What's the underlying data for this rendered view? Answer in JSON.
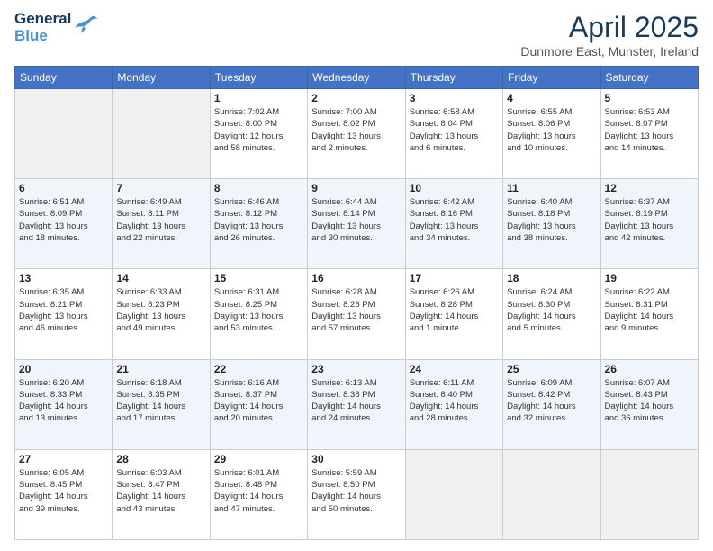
{
  "header": {
    "logo_general": "General",
    "logo_blue": "Blue",
    "month_title": "April 2025",
    "subtitle": "Dunmore East, Munster, Ireland"
  },
  "days_of_week": [
    "Sunday",
    "Monday",
    "Tuesday",
    "Wednesday",
    "Thursday",
    "Friday",
    "Saturday"
  ],
  "weeks": [
    [
      {
        "num": "",
        "info": ""
      },
      {
        "num": "",
        "info": ""
      },
      {
        "num": "1",
        "info": "Sunrise: 7:02 AM\nSunset: 8:00 PM\nDaylight: 12 hours\nand 58 minutes."
      },
      {
        "num": "2",
        "info": "Sunrise: 7:00 AM\nSunset: 8:02 PM\nDaylight: 13 hours\nand 2 minutes."
      },
      {
        "num": "3",
        "info": "Sunrise: 6:58 AM\nSunset: 8:04 PM\nDaylight: 13 hours\nand 6 minutes."
      },
      {
        "num": "4",
        "info": "Sunrise: 6:55 AM\nSunset: 8:06 PM\nDaylight: 13 hours\nand 10 minutes."
      },
      {
        "num": "5",
        "info": "Sunrise: 6:53 AM\nSunset: 8:07 PM\nDaylight: 13 hours\nand 14 minutes."
      }
    ],
    [
      {
        "num": "6",
        "info": "Sunrise: 6:51 AM\nSunset: 8:09 PM\nDaylight: 13 hours\nand 18 minutes."
      },
      {
        "num": "7",
        "info": "Sunrise: 6:49 AM\nSunset: 8:11 PM\nDaylight: 13 hours\nand 22 minutes."
      },
      {
        "num": "8",
        "info": "Sunrise: 6:46 AM\nSunset: 8:12 PM\nDaylight: 13 hours\nand 26 minutes."
      },
      {
        "num": "9",
        "info": "Sunrise: 6:44 AM\nSunset: 8:14 PM\nDaylight: 13 hours\nand 30 minutes."
      },
      {
        "num": "10",
        "info": "Sunrise: 6:42 AM\nSunset: 8:16 PM\nDaylight: 13 hours\nand 34 minutes."
      },
      {
        "num": "11",
        "info": "Sunrise: 6:40 AM\nSunset: 8:18 PM\nDaylight: 13 hours\nand 38 minutes."
      },
      {
        "num": "12",
        "info": "Sunrise: 6:37 AM\nSunset: 8:19 PM\nDaylight: 13 hours\nand 42 minutes."
      }
    ],
    [
      {
        "num": "13",
        "info": "Sunrise: 6:35 AM\nSunset: 8:21 PM\nDaylight: 13 hours\nand 46 minutes."
      },
      {
        "num": "14",
        "info": "Sunrise: 6:33 AM\nSunset: 8:23 PM\nDaylight: 13 hours\nand 49 minutes."
      },
      {
        "num": "15",
        "info": "Sunrise: 6:31 AM\nSunset: 8:25 PM\nDaylight: 13 hours\nand 53 minutes."
      },
      {
        "num": "16",
        "info": "Sunrise: 6:28 AM\nSunset: 8:26 PM\nDaylight: 13 hours\nand 57 minutes."
      },
      {
        "num": "17",
        "info": "Sunrise: 6:26 AM\nSunset: 8:28 PM\nDaylight: 14 hours\nand 1 minute."
      },
      {
        "num": "18",
        "info": "Sunrise: 6:24 AM\nSunset: 8:30 PM\nDaylight: 14 hours\nand 5 minutes."
      },
      {
        "num": "19",
        "info": "Sunrise: 6:22 AM\nSunset: 8:31 PM\nDaylight: 14 hours\nand 9 minutes."
      }
    ],
    [
      {
        "num": "20",
        "info": "Sunrise: 6:20 AM\nSunset: 8:33 PM\nDaylight: 14 hours\nand 13 minutes."
      },
      {
        "num": "21",
        "info": "Sunrise: 6:18 AM\nSunset: 8:35 PM\nDaylight: 14 hours\nand 17 minutes."
      },
      {
        "num": "22",
        "info": "Sunrise: 6:16 AM\nSunset: 8:37 PM\nDaylight: 14 hours\nand 20 minutes."
      },
      {
        "num": "23",
        "info": "Sunrise: 6:13 AM\nSunset: 8:38 PM\nDaylight: 14 hours\nand 24 minutes."
      },
      {
        "num": "24",
        "info": "Sunrise: 6:11 AM\nSunset: 8:40 PM\nDaylight: 14 hours\nand 28 minutes."
      },
      {
        "num": "25",
        "info": "Sunrise: 6:09 AM\nSunset: 8:42 PM\nDaylight: 14 hours\nand 32 minutes."
      },
      {
        "num": "26",
        "info": "Sunrise: 6:07 AM\nSunset: 8:43 PM\nDaylight: 14 hours\nand 36 minutes."
      }
    ],
    [
      {
        "num": "27",
        "info": "Sunrise: 6:05 AM\nSunset: 8:45 PM\nDaylight: 14 hours\nand 39 minutes."
      },
      {
        "num": "28",
        "info": "Sunrise: 6:03 AM\nSunset: 8:47 PM\nDaylight: 14 hours\nand 43 minutes."
      },
      {
        "num": "29",
        "info": "Sunrise: 6:01 AM\nSunset: 8:48 PM\nDaylight: 14 hours\nand 47 minutes."
      },
      {
        "num": "30",
        "info": "Sunrise: 5:59 AM\nSunset: 8:50 PM\nDaylight: 14 hours\nand 50 minutes."
      },
      {
        "num": "",
        "info": ""
      },
      {
        "num": "",
        "info": ""
      },
      {
        "num": "",
        "info": ""
      }
    ]
  ]
}
